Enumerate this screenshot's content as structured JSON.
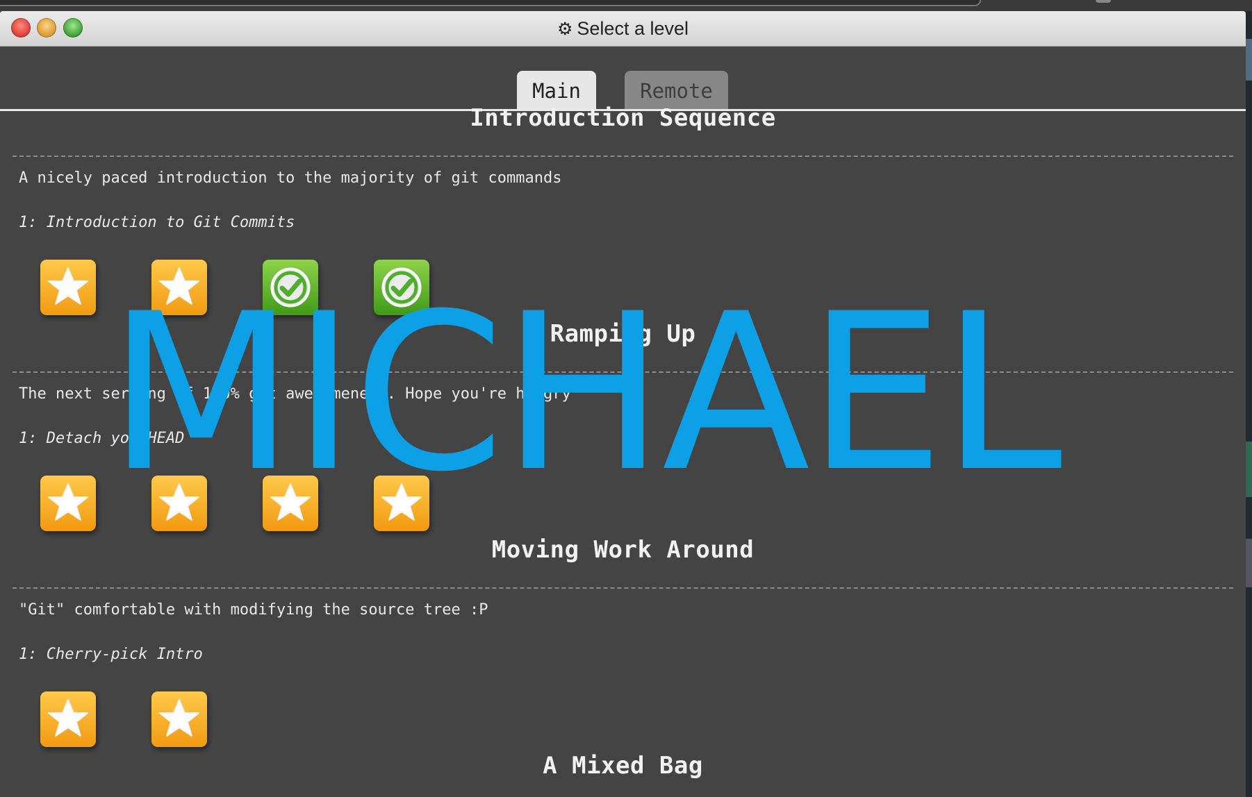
{
  "window": {
    "title": "Select a level",
    "title_icon": "gear-icon"
  },
  "tabs": [
    {
      "label": "Main",
      "selected": true
    },
    {
      "label": "Remote",
      "selected": false
    }
  ],
  "sections": [
    {
      "title": "Introduction Sequence",
      "description": "A nicely paced introduction to the majority of git commands",
      "level_label": "1: Introduction to Git Commits",
      "levels": [
        "star",
        "star",
        "check",
        "check"
      ]
    },
    {
      "title": "Ramping Up",
      "description": "The next serving of 100% git awesomeness. Hope you're hungry",
      "level_label": "1: Detach yo' HEAD",
      "levels": [
        "star",
        "star",
        "star",
        "star"
      ]
    },
    {
      "title": "Moving Work Around",
      "description": "\"Git\" comfortable with modifying the source tree :P",
      "level_label": "1: Cherry-pick Intro",
      "levels": [
        "star",
        "star"
      ]
    },
    {
      "title": "A Mixed Bag"
    }
  ],
  "watermark": {
    "text": "MICHAEL",
    "color": "#0ea0e6"
  },
  "colors": {
    "background": "#444444",
    "star_tile": "#f7aa1f",
    "check_tile": "#5fb32c"
  }
}
